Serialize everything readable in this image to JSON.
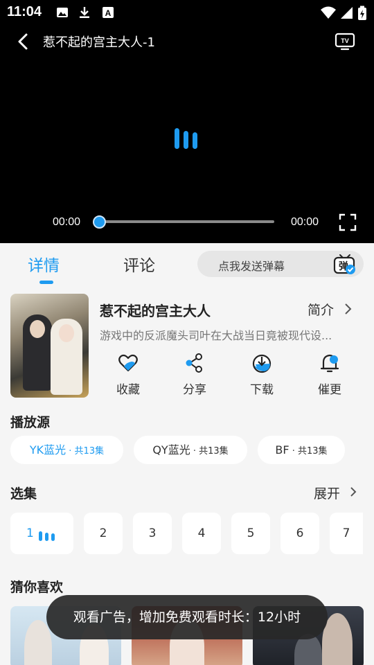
{
  "status_bar": {
    "time": "11:04",
    "left_icons": [
      "image-icon",
      "download-icon",
      "font-a-icon"
    ],
    "right_icons": [
      "wifi-icon",
      "signal-icon",
      "battery-charging-icon"
    ]
  },
  "player": {
    "title": "惹不起的宫主大人-1",
    "current_time": "00:00",
    "total_time": "00:00",
    "progress": 0,
    "state": "loading",
    "accent_color": "#1e9bf0"
  },
  "tabs": {
    "detail": "详情",
    "comment": "评论",
    "active": "detail"
  },
  "danmu": {
    "placeholder": "点我发送弹幕",
    "icon_glyph": "弹"
  },
  "show": {
    "name": "惹不起的宫主大人",
    "intro_label": "简介",
    "synopsis": "游戏中的反派魔头司叶在大战当日竟被现代设...",
    "actions": [
      {
        "label": "收藏",
        "icon": "heart-icon"
      },
      {
        "label": "分享",
        "icon": "share-icon"
      },
      {
        "label": "下载",
        "icon": "download-icon"
      },
      {
        "label": "催更",
        "icon": "bell-icon"
      }
    ]
  },
  "sources": {
    "title": "播放源",
    "items": [
      {
        "name": "YK蓝光",
        "count": " · 共13集",
        "active": true
      },
      {
        "name": "QY蓝光",
        "count": " · 共13集",
        "active": false
      },
      {
        "name": "BF",
        "count": " · 共13集",
        "active": false
      }
    ]
  },
  "episodes": {
    "title": "选集",
    "expand_label": "展开",
    "items": [
      "1",
      "2",
      "3",
      "4",
      "5",
      "6",
      "7"
    ],
    "current": "1"
  },
  "recommend": {
    "title": "猜你喜欢"
  },
  "toast": {
    "text": "观看广告，增加免费观看时长：12小时"
  }
}
